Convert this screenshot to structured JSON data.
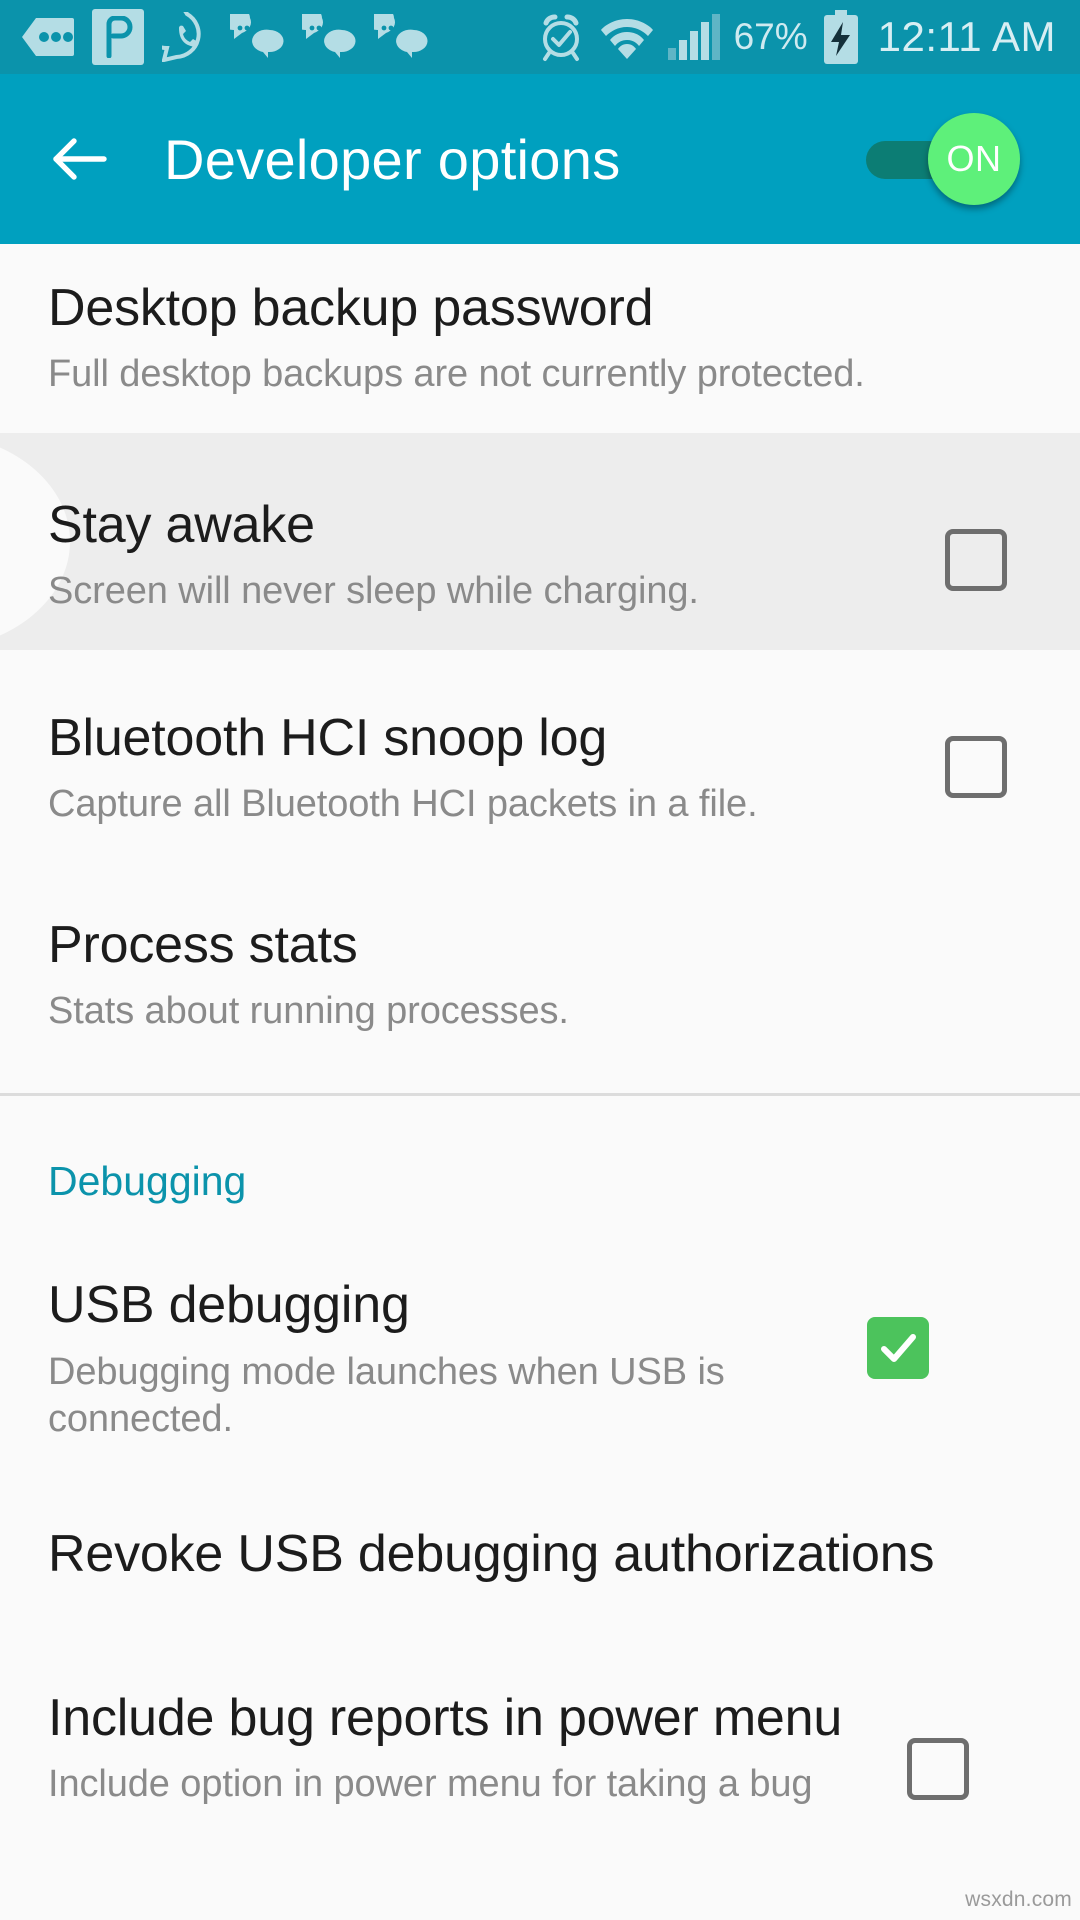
{
  "status_bar": {
    "battery_percent": "67%",
    "time": "12:11 AM",
    "icons": [
      "more-notifications-icon",
      "app-p-icon",
      "whatsapp-icon",
      "chat-bubble-icon",
      "chat-bubble-icon",
      "chat-bubble-icon",
      "alarm-clock-icon",
      "wifi-icon",
      "cellular-signal-icon",
      "battery-charging-icon"
    ],
    "background_color": "#0b93ab"
  },
  "action_bar": {
    "back_label": "back-arrow",
    "title": "Developer options",
    "toggle_label": "ON",
    "toggle_state": "on",
    "background_color": "#00a0bf",
    "toggle_thumb_color": "#5ef07a",
    "toggle_track_color": "#0c7d74"
  },
  "settings": {
    "rows": [
      {
        "title": "Desktop backup password",
        "subtitle": "Full desktop backups are not currently protected.",
        "control": "none",
        "highlighted": false
      },
      {
        "title": "Stay awake",
        "subtitle": "Screen will never sleep while charging.",
        "control": "checkbox",
        "checked": false,
        "highlighted": true
      },
      {
        "title": "Bluetooth HCI snoop log",
        "subtitle": "Capture all Bluetooth HCI packets in a file.",
        "control": "checkbox",
        "checked": false,
        "highlighted": false
      },
      {
        "title": "Process stats",
        "subtitle": "Stats about running processes.",
        "control": "none",
        "highlighted": false
      }
    ]
  },
  "debugging_section": {
    "header": "Debugging",
    "header_color": "#0b93ab",
    "rows": [
      {
        "title": "USB debugging",
        "subtitle": "Debugging mode launches when USB is connected.",
        "control": "checkbox",
        "checked": true,
        "highlighted": false
      },
      {
        "title": "Revoke USB debugging authorizations",
        "subtitle": "",
        "control": "none",
        "highlighted": false
      },
      {
        "title": "Include bug reports in power menu",
        "subtitle": "Include option in power menu for taking a bug",
        "control": "checkbox",
        "checked": false,
        "highlighted": false
      }
    ]
  },
  "watermark": "wsxdn.com"
}
